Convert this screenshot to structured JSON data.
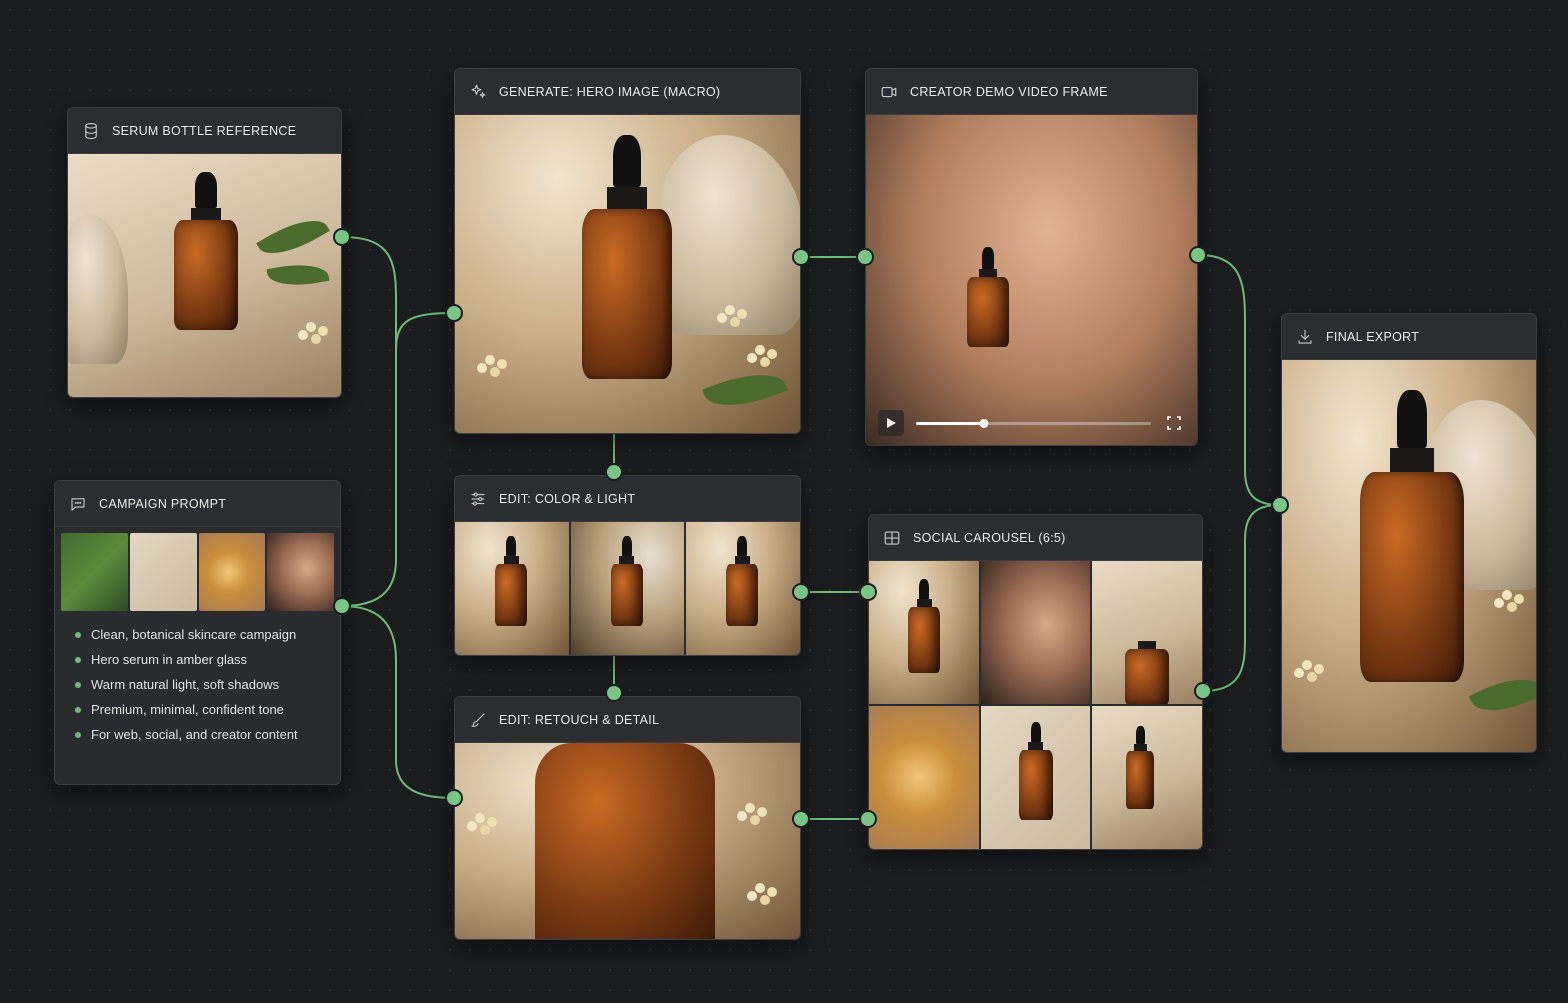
{
  "accent": "#6dbb7a",
  "nodes": {
    "serum_reference": {
      "title": "SERUM BOTTLE REFERENCE",
      "icon": "database-icon"
    },
    "campaign_prompt": {
      "title": "CAMPAIGN PROMPT",
      "icon": "chat-bubble-icon",
      "bullets": [
        "Clean, botanical skincare campaign",
        "Hero serum in amber glass",
        "Warm natural light, soft shadows",
        "Premium, minimal, confident tone",
        "For web, social, and creator content"
      ]
    },
    "hero_image": {
      "title": "GENERATE: HERO IMAGE (MACRO)",
      "icon": "sparkle-icon"
    },
    "color_light": {
      "title": "EDIT: COLOR & LIGHT",
      "icon": "sliders-icon"
    },
    "retouch": {
      "title": "EDIT: RETOUCH & DETAIL",
      "icon": "brush-icon"
    },
    "video_frame": {
      "title": "CREATOR DEMO VIDEO FRAME",
      "icon": "video-camera-icon",
      "progress": 0.29
    },
    "carousel": {
      "title": "SOCIAL CAROUSEL (6:5)",
      "icon": "grid-icon"
    },
    "final_export": {
      "title": "FINAL EXPORT",
      "icon": "download-icon"
    }
  }
}
